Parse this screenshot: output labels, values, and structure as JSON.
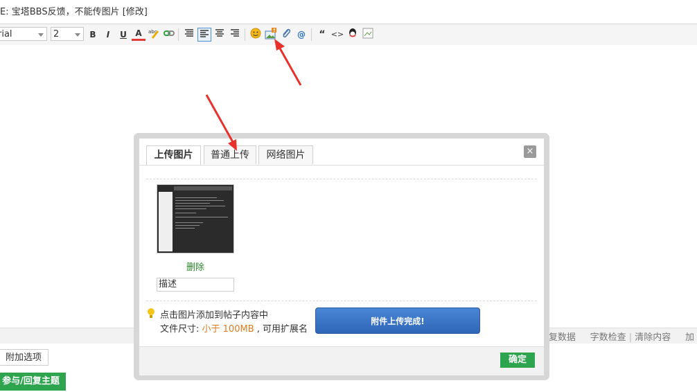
{
  "title_line": "E: 宝塔BBS反馈，不能传图片 [修改]",
  "toolbar": {
    "font": "rial",
    "size": "2",
    "bold": "B",
    "italic": "I",
    "underline": "U",
    "font_color": "A",
    "quote": "“",
    "code": "<>",
    "icons": [
      "bold-icon",
      "italic-icon",
      "underline-icon",
      "font-color-icon",
      "highlight-icon",
      "link-icon",
      "align-left-icon",
      "align-center-icon",
      "align-right-icon",
      "emoji-icon",
      "image-icon",
      "attachment-icon",
      "mention-icon",
      "quote-icon",
      "code-icon",
      "qq-icon",
      "broken-image-icon"
    ]
  },
  "status_bar": {
    "restore": "恢复数据",
    "word_check": "字数检查",
    "clear": "清除内容",
    "more": "加"
  },
  "extra_options": "附加选项",
  "reply_button": "参与/回复主题",
  "dialog": {
    "tabs": [
      "上传图片",
      "普通上传",
      "网络图片"
    ],
    "active_tab": "上传图片",
    "close": "×",
    "delete": "删除",
    "description_placeholder": "描述",
    "tip1": "点击图片添加到帖子内容中",
    "size_label": "文件尺寸:",
    "size_value": "小于 100MB",
    "ext_label": ", 可用扩展名",
    "upload_complete": "附件上传完成!",
    "confirm": "确定"
  },
  "colors": {
    "accent_green": "#2ea44f",
    "toast_blue": "#3b77c8",
    "arrow_red": "#e8312a"
  }
}
